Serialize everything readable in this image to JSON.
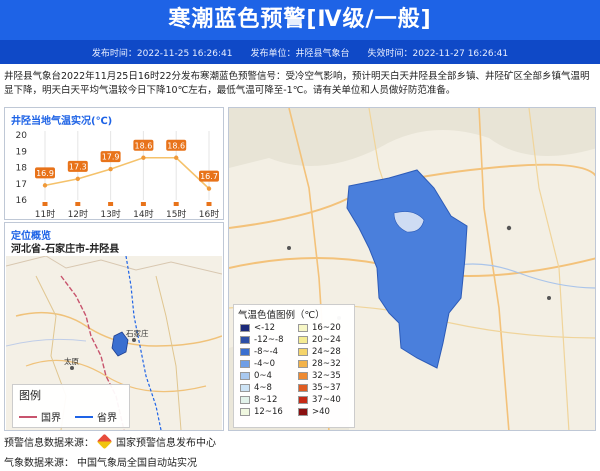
{
  "header": {
    "title": "寒潮蓝色预警[Ⅳ级/一般]",
    "issue_time_label": "发布时间：",
    "issue_time": "2022-11-25 16:26:41",
    "issuer_label": "发布单位：",
    "issuer": "井陉县气象台",
    "expire_label": "失效时间：",
    "expire_time": "2022-11-27 16:26:41"
  },
  "notice": "井陉县气象台2022年11月25日16时22分发布寒潮蓝色预警信号：受冷空气影响，预计明天白天井陉县全部乡镇、井陉矿区全部乡镇气温明显下降，明天白天平均气温较今日下降10℃左右，最低气温可降至-1℃。请有关单位和人员做好防范准备。",
  "temp_panel": {
    "title": "井陉当地气温实况(℃)"
  },
  "chart_data": {
    "type": "line",
    "title": "井陉当地气温实况(℃)",
    "categories": [
      "11时",
      "12时",
      "13时",
      "14时",
      "15时",
      "16时"
    ],
    "values": [
      16.9,
      17.3,
      17.9,
      18.6,
      18.6,
      16.7
    ],
    "value_labels": [
      "16.9",
      "17.3",
      "17.9",
      "18.6",
      "18.6",
      "16.7"
    ],
    "y_ticks": [
      "16",
      "17",
      "18",
      "19",
      "20"
    ],
    "ylim": [
      16,
      20
    ],
    "grid": "vertical",
    "colors": {
      "line": "#f5c26b",
      "label_bg": "#e8731a",
      "tick": "#e8731a"
    }
  },
  "location": {
    "title": "定位概览",
    "region": "河北省-石家庄市-井陉县",
    "city_labels": {
      "shijiazhuang": "石家庄",
      "taiyuan": "太原"
    }
  },
  "map_legend": {
    "title": "图例",
    "items": [
      {
        "label": "国界",
        "color": "#c8546d"
      },
      {
        "label": "省界",
        "color": "#1e63e6"
      }
    ]
  },
  "color_legend": {
    "title": "气温色值图例（℃）",
    "left": [
      {
        "label": "<-12",
        "color": "#1b2a7a"
      },
      {
        "label": "-12~-8",
        "color": "#2d4fa6"
      },
      {
        "label": "-8~-4",
        "color": "#3a6fd0"
      },
      {
        "label": "-4~0",
        "color": "#6f9ee6"
      },
      {
        "label": "0~4",
        "color": "#a9c9f0"
      },
      {
        "label": "4~8",
        "color": "#cde3f5"
      },
      {
        "label": "8~12",
        "color": "#e2f2ea"
      },
      {
        "label": "12~16",
        "color": "#f0f8e0"
      }
    ],
    "right": [
      {
        "label": "16~20",
        "color": "#f7f7c6"
      },
      {
        "label": "20~24",
        "color": "#f5ec93"
      },
      {
        "label": "24~28",
        "color": "#f5d46a"
      },
      {
        "label": "28~32",
        "color": "#f2b24a"
      },
      {
        "label": "32~35",
        "color": "#ee8a32"
      },
      {
        "label": "35~37",
        "color": "#e05c22"
      },
      {
        "label": "37~40",
        "color": "#c52a16"
      },
      {
        "label": ">40",
        "color": "#8a1010"
      }
    ]
  },
  "footer": {
    "warning_source_label": "预警信息数据来源：",
    "warning_source": "国家预警信息发布中心",
    "weather_source_label": "气象数据来源：",
    "weather_source": "中国气象局全国自动站实况"
  }
}
